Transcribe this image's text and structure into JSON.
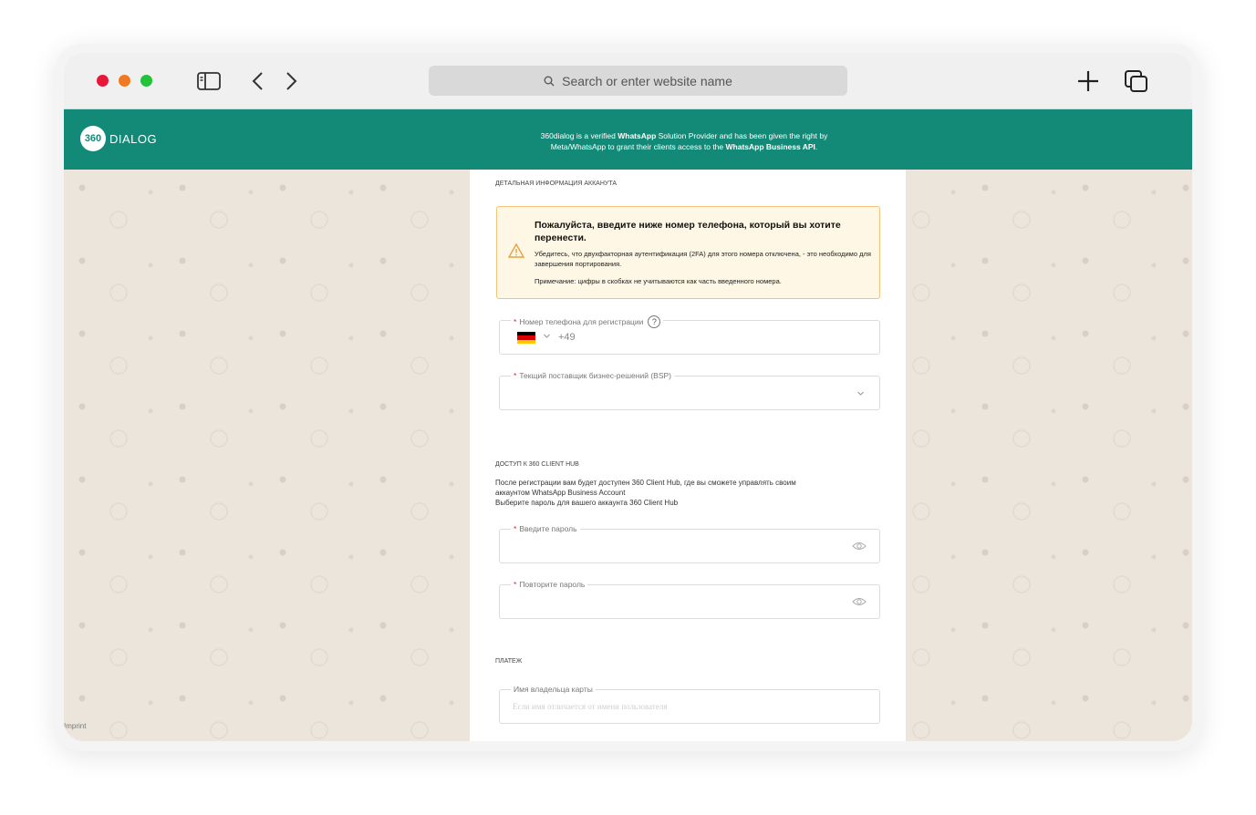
{
  "browser": {
    "address_placeholder": "Search or enter website name",
    "icons": [
      "sidebar-icon",
      "back-icon",
      "forward-icon",
      "search-icon",
      "plus-icon",
      "tabs-icon"
    ]
  },
  "banner": {
    "logo_number": "360",
    "logo_text": "DIALOG",
    "line1_pre": "360dialog is a verified ",
    "line1_bold": "WhatsApp",
    "line1_post": " Solution Provider and has been given the right by",
    "line2_pre": "Meta/WhatsApp to grant their clients access to the ",
    "line2_bold": "WhatsApp Business API",
    "line2_post": "."
  },
  "footer": {
    "imprint": "Imprint"
  },
  "form": {
    "account_section": "ДЕТАЛЬНАЯ ИНФОРМАЦИЯ АККАНУТА",
    "warning": {
      "title": "Пожалуйста, введите ниже номер телефона, который вы хотите перенести.",
      "text": "Убедитесь, что двухфакторная аутентификация (2FA) для этого номера отключена, - это необходимо для завершения портирования.",
      "note": "Примечание: цифры в скобках не учитываются как часть введенного номера."
    },
    "phone": {
      "label": "Номер телефона для регистрации",
      "help": "?",
      "dial_code": "+49"
    },
    "bsp": {
      "label": "Текщий поставщик бизнес-решений (BSP)"
    },
    "hub_section": "ДОСТУП К 360 CLIENT HUB",
    "hub_text_1": "После регистрации вам будет доступен 360 Client Hub, где вы сможете управлять своим",
    "hub_text_2": "аккаунтом WhatsApp Business Account",
    "hub_text_3": "Выберите пароль для вашего аккаунта 360 Client Hub",
    "password": {
      "label": "Введите пароль"
    },
    "password_repeat": {
      "label": "Повторите пароль"
    },
    "payment_section": "ПЛАТЕЖ",
    "card_holder": {
      "label": "Имя владельца карты",
      "placeholder": "Если имя отличается от имени пользователя"
    },
    "required_mark": "*"
  },
  "colors": {
    "brand_green": "#138a77",
    "warning_bg": "#fff7e5",
    "warning_border": "#f1c47a",
    "required": "#e02424"
  }
}
